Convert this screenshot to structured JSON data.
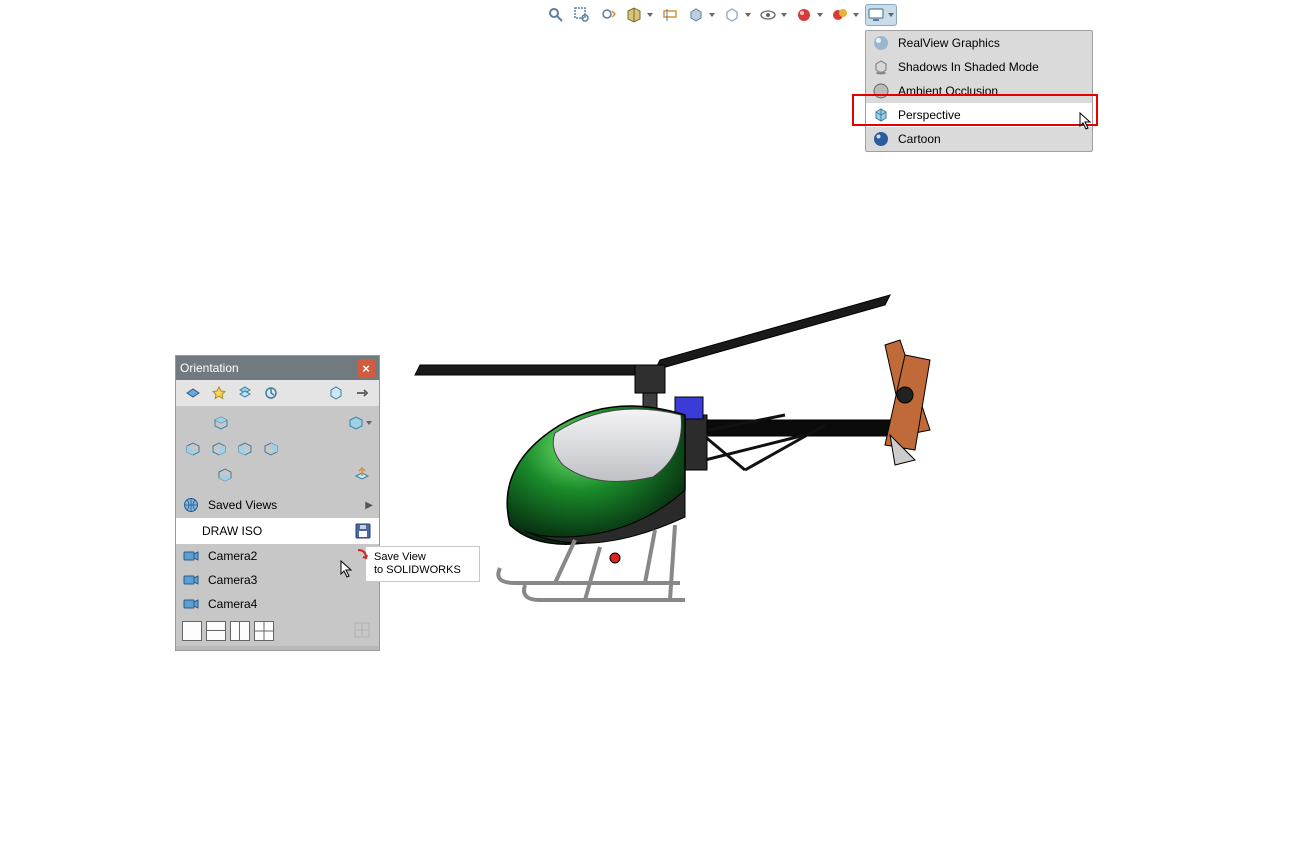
{
  "hud": {
    "icons": [
      "zoom-to-fit",
      "zoom-area",
      "previous-view",
      "section-view",
      "dynamic-annotation",
      "display-style",
      "hide-show",
      "view-orientation",
      "edit-appearance",
      "apply-scene",
      "view-settings"
    ]
  },
  "viewSettingsMenu": {
    "items": [
      {
        "icon": "realview-sphere",
        "label": "RealView Graphics"
      },
      {
        "icon": "shadows-cube",
        "label": "Shadows In Shaded Mode"
      },
      {
        "icon": "ambient-sphere",
        "label": "Ambient Occlusion"
      },
      {
        "icon": "perspective-cube",
        "label": "Perspective"
      },
      {
        "icon": "cartoon-sphere",
        "label": "Cartoon"
      }
    ]
  },
  "orientationPanel": {
    "title": "Orientation",
    "sectionSavedViews": "Saved Views",
    "drawIso": "DRAW ISO",
    "tooltipLine1": "Save View",
    "tooltipLine2": "to SOLIDWORKS",
    "cameras": [
      "Camera2",
      "Camera3",
      "Camera4"
    ]
  }
}
